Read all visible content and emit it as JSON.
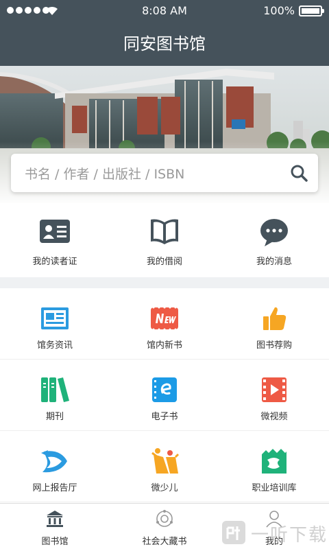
{
  "status_bar": {
    "time": "8:08 AM",
    "battery": "100%"
  },
  "header": {
    "title": "同安图书馆"
  },
  "search": {
    "placeholder": "书名 / 作者 / 出版社 / ISBN",
    "icon": "search-icon"
  },
  "quick_actions": [
    {
      "label": "我的读者证",
      "icon": "reader-card-icon"
    },
    {
      "label": "我的借阅",
      "icon": "open-book-icon"
    },
    {
      "label": "我的消息",
      "icon": "chat-bubble-icon"
    }
  ],
  "grid": [
    {
      "label": "馆务资讯",
      "icon": "newspaper-icon",
      "color": "#2b9be0"
    },
    {
      "label": "馆内新书",
      "icon": "new-badge-icon",
      "color": "#ee5a45"
    },
    {
      "label": "图书荐购",
      "icon": "thumbs-up-icon",
      "color": "#f6a623"
    },
    {
      "label": "期刊",
      "icon": "journals-icon",
      "color": "#1fb27a"
    },
    {
      "label": "电子书",
      "icon": "ebook-icon",
      "color": "#1c9be6"
    },
    {
      "label": "微视频",
      "icon": "video-film-icon",
      "color": "#ee5a45"
    },
    {
      "label": "网上报告厅",
      "icon": "lecture-hall-icon",
      "color": "#2b9be0"
    },
    {
      "label": "微少儿",
      "icon": "children-icon",
      "color": "#f6a623"
    },
    {
      "label": "职业培训库",
      "icon": "training-icon",
      "color": "#1fb27a"
    }
  ],
  "tabbar": [
    {
      "label": "图书馆",
      "icon": "library-icon"
    },
    {
      "label": "社会大藏书",
      "icon": "collection-icon"
    },
    {
      "label": "我的",
      "icon": "user-icon"
    }
  ],
  "watermark": {
    "text": "一听下载"
  },
  "colors": {
    "header_bg": "#45525b",
    "divider": "#eff1f3",
    "icon_dark": "#45525b"
  }
}
